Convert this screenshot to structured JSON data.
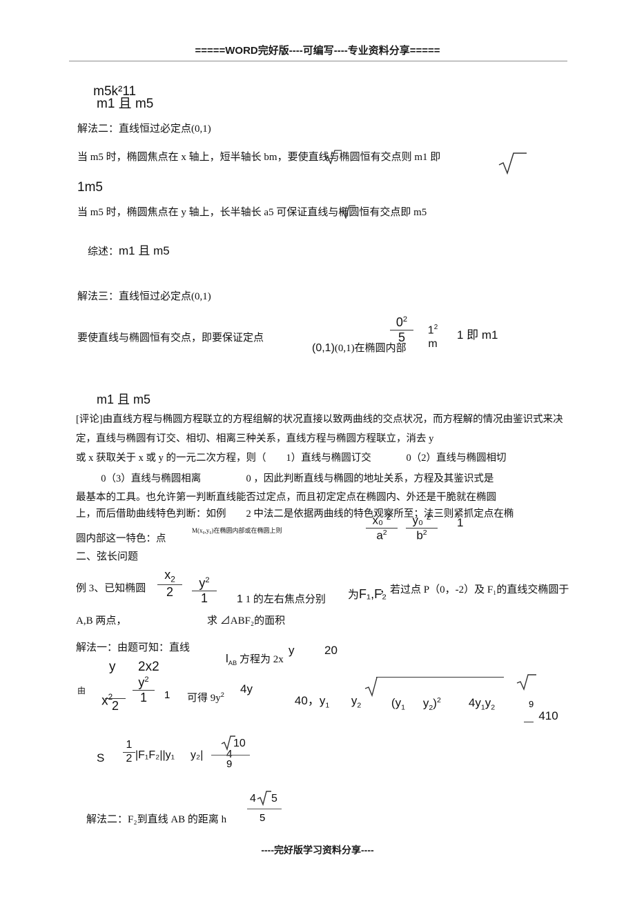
{
  "header": {
    "text": "=====WORD完好版----可编写----专业资料分享====="
  },
  "footer": {
    "text": "----完好版学习资料分享----"
  },
  "body": {
    "line_m5k": "m5k²11",
    "line_m1_and_m5_a": "m1 且 m5",
    "solution2_title": "解法二：直线恒过必定点(0,1)",
    "solution2_case1": "当 m5 时，椭圆焦点在 x 轴上，短半轴长 bm，要使直线与椭圆恒有交点则 m1 即",
    "solution2_case1_cont": "1m5",
    "solution2_case2": "当 m5 时，椭圆焦点在 y 轴上，长半轴长 a5 可保证直线与椭圆恒有交点即 m5",
    "solution2_summary_label": "综述：",
    "solution2_summary_value": "m1 且 m5",
    "solution3_title": "解法三：直线恒过必定点(0,1)",
    "solution3_lead": "要使直线与椭圆恒有交点，即要保证定点",
    "solution3_point": "(0,1)在椭圆内部",
    "solution3_frac1_num": "0",
    "solution3_frac1_num_sup": "2",
    "solution3_frac1_den": "5",
    "solution3_frac2_num": "1",
    "solution3_frac2_num_sup": "2",
    "solution3_frac2_den": "m",
    "solution3_tail": "1 即 m1",
    "line_m1_and_m5_b": "m1 且 m5",
    "comment_paragraph": "[评论]由直线方程与椭圆方程联立的方程组解的状况直接以致两曲线的交点状况，而方程解的情况由鉴识式来决定，直线与椭圆有订交、相切、相离三种关系，直线方程与椭圆方程联立，消去 y",
    "comment_line3": "或 x 获取关于 x 或 y 的一元二次方程，则（        1）直线与椭圆订交              0（2）直线与椭圆相切",
    "comment_line4": "          0（3）直线与椭圆相离                  0 ，因此判断直线与椭圆的地址关系，方程及其鉴识式是",
    "comment_line5": "最基本的工具。也允许第一判断直线能否过定点，而且初定定点在椭圆内、外还是干脆就在椭圆",
    "comment_line6": "上，而后借助曲线特色判断：如例        2 中法二是依据两曲线的特色观察所至；法三则紧抓定点在椭",
    "comment_line7": "圆内部这一特色：点",
    "point_note": "M(x₀,y₀)在椭圆内部或在椭圆上则",
    "point_frac1_num": "x₀",
    "point_frac1_num_sup": "2",
    "point_frac1_den": "a",
    "point_frac1_den_sup": "2",
    "point_frac2_num": "y₀",
    "point_frac2_num_sup": "2",
    "point_frac2_den": "b",
    "point_frac2_den_sup": "2",
    "point_tail": "1",
    "section2_title": "二、弦长问题",
    "example3_lead": "例 3、已知椭圆",
    "example3_frac1_num": "x",
    "example3_frac1_num_sup": "2",
    "example3_frac1_den": "2",
    "example3_frac2_num": "y",
    "example3_frac2_num_sup": "2",
    "example3_frac2_den": "1",
    "example3_mid": "1 的左右焦点分别",
    "example3_foci_label": "为",
    "example3_foci": "F₁,F₂",
    "example3_tail": "，若过点 P（0，-2）及 F₁的直线交椭圆于",
    "example3_line2_a": "A,B 两点，",
    "example3_line2_b": "求 ⊿ABF₂的面积",
    "solution1_title": "解法一：由题可知：直线",
    "solution1_lab": "l",
    "solution1_lab_sub": "AB",
    "solution1_eq": "方程为 2x",
    "solution1_eq_y": "y",
    "solution1_eq_tail": "20",
    "sys_label": "由",
    "sys_top_y": "y",
    "sys_top_expr": "2x2",
    "sys_frac1_num": "x",
    "sys_frac1_num_sup": "2",
    "sys_frac1_den": "2",
    "sys_frac2_num": "y",
    "sys_frac2_num_sup": "2",
    "sys_frac2_den": "1",
    "sys_eq_one": "1",
    "sys_result_a": "可得 9y",
    "sys_result_a_sup": "2",
    "sys_result_b": "4y",
    "sys_result_c": "40，y",
    "sys_result_c_sub": "1",
    "sys_result_d": "y",
    "sys_result_d_sub": "2",
    "sqrt_inner_a": "(y",
    "sqrt_inner_a_sub": "1",
    "sqrt_inner_b": "y",
    "sqrt_inner_b_sub": "2",
    "sqrt_inner_c": ")",
    "sqrt_inner_c_sup": "2",
    "sqrt_inner_d": "4y",
    "sqrt_inner_d_sub1": "1",
    "sqrt_inner_e": "y",
    "sqrt_inner_e_sub": "2",
    "result_frac_num": "410",
    "result_frac_den": "9",
    "area_s": "S",
    "area_half_num": "1",
    "area_half_den": "2",
    "area_expr": "|F₁F₂||y₁",
    "area_expr_b": "y₂|",
    "area_frac_num_coef": "4",
    "area_frac_num_rad": "10",
    "area_frac_den": "9",
    "solution2b_title": "解法二：F₂到直线 AB 的距离 h",
    "dist_frac_num_coef": "4",
    "dist_frac_num_rad": "5",
    "dist_frac_den": "5"
  }
}
